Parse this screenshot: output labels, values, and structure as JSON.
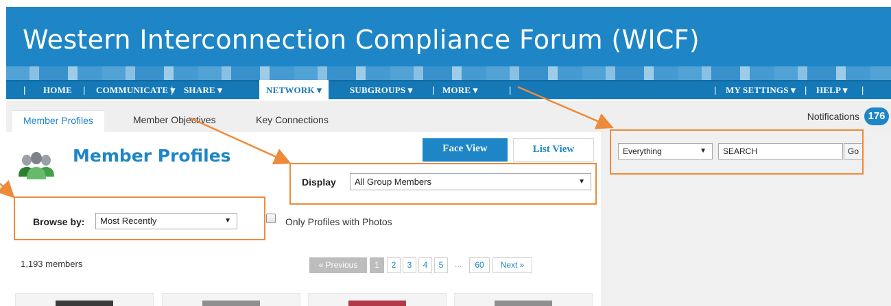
{
  "banner": {
    "title": "Western Interconnection Compliance Forum (WICF)"
  },
  "nav": {
    "left": [
      {
        "label": "HOME"
      },
      {
        "label": "COMMUNICATE ▾"
      },
      {
        "label": "SHARE ▾"
      },
      {
        "label": "NETWORK ▾"
      },
      {
        "label": "SUBGROUPS ▾"
      },
      {
        "label": "MORE ▾"
      }
    ],
    "right": [
      {
        "label": "MY SETTINGS ▾"
      },
      {
        "label": "HELP ▾"
      }
    ],
    "separator": "|"
  },
  "tabs": [
    {
      "label": "Member Profiles"
    },
    {
      "label": "Member Objectives"
    },
    {
      "label": "Key Connections"
    }
  ],
  "notifications": {
    "label": "Notifications",
    "count": "176"
  },
  "page": {
    "title": "Member Profiles"
  },
  "views": {
    "face": "Face View",
    "list": "List View"
  },
  "display": {
    "label": "Display",
    "value": "All Group Members"
  },
  "browse": {
    "label": "Browse by:",
    "value": "Most Recently"
  },
  "filter": {
    "label": "Only Profiles with Photos"
  },
  "members": {
    "count": "1,193 members"
  },
  "pagination": {
    "prev": "« Previous",
    "pages": [
      "1",
      "2",
      "3",
      "4",
      "5"
    ],
    "ellipsis": "...",
    "last": "60",
    "next": "Next »"
  },
  "search": {
    "scope": "Everything",
    "value": "SEARCH",
    "go": "Go"
  },
  "colors": {
    "brand": "#1e86c6",
    "nav": "#1579b8",
    "annotation": "#ee8a3a"
  },
  "icons": {
    "group": "group-people-icon",
    "dropdown": "dropdown-arrow-icon"
  }
}
